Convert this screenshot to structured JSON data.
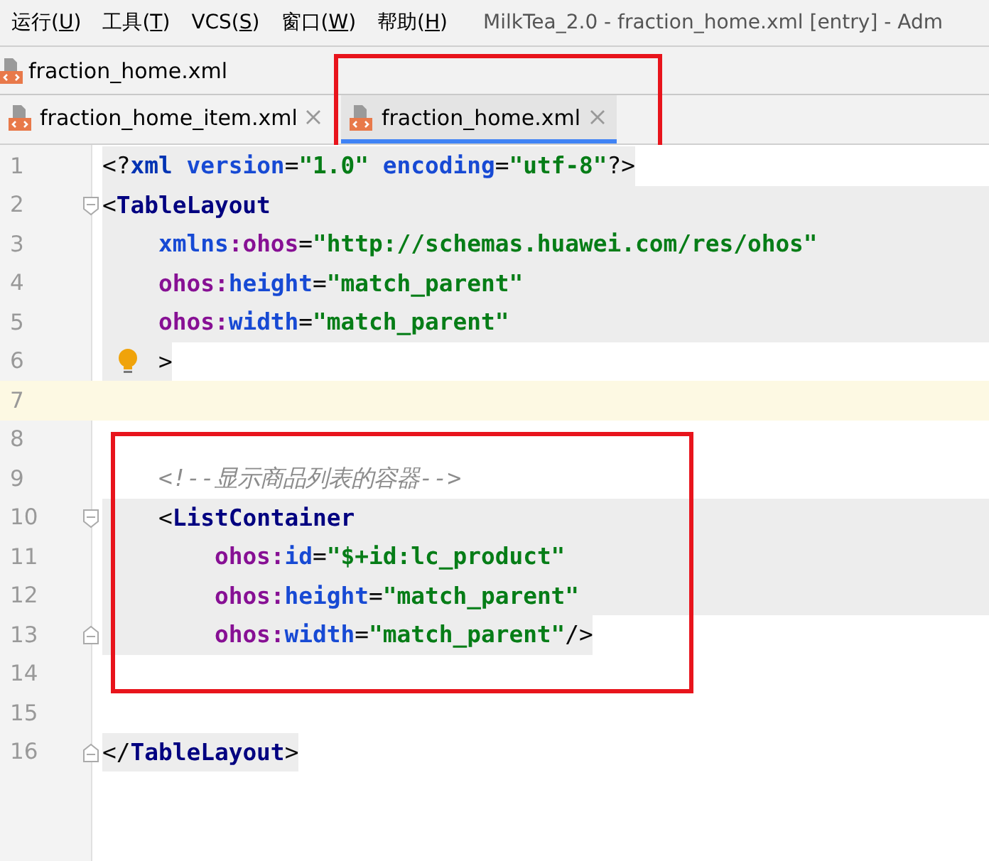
{
  "menu": [
    {
      "label": "运行(",
      "key": "U",
      "tail": ")"
    },
    {
      "label": "工具(",
      "key": "T",
      "tail": ")"
    },
    {
      "label": "VCS(",
      "key": "S",
      "tail": ")"
    },
    {
      "label": "窗口(",
      "key": "W",
      "tail": ")"
    },
    {
      "label": "帮助(",
      "key": "H",
      "tail": ")"
    }
  ],
  "window": {
    "title": "MilkTea_2.0 - fraction_home.xml [entry] - Adm"
  },
  "breadcrumb": {
    "file": "fraction_home.xml"
  },
  "tabs": [
    {
      "label": "fraction_home_item.xml",
      "selected": false,
      "annotated": false
    },
    {
      "label": "fraction_home.xml",
      "selected": true,
      "annotated": true
    }
  ],
  "blocks": [
    {
      "framed": false,
      "lines": [
        {
          "number": "1",
          "text": "<?xml version=\"1.0\" encoding=\"utf-8\"?>",
          "shaded": true,
          "shaded_full": false,
          "current": false,
          "bulb": false
        },
        {
          "number": "2",
          "text": "<TableLayout",
          "shaded": true,
          "shaded_full": true,
          "current": false,
          "bulb": false
        },
        {
          "number": "3",
          "text": "    xmlns:ohos=\"http://schemas.huawei.com/res/ohos\"",
          "shaded": true,
          "shaded_full": true,
          "current": false,
          "bulb": false
        },
        {
          "number": "4",
          "text": "    ohos:height=\"match_parent\"",
          "shaded": true,
          "shaded_full": true,
          "current": false,
          "bulb": false
        },
        {
          "number": "5",
          "text": "    ohos:width=\"match_parent\"",
          "shaded": true,
          "shaded_full": true,
          "current": false,
          "bulb": false
        },
        {
          "number": "6",
          "text": "    >",
          "shaded": true,
          "shaded_full": false,
          "current": false,
          "bulb": true
        },
        {
          "number": "7",
          "current": true,
          "bulb": false
        }
      ]
    },
    {
      "framed": true,
      "lines": [
        {
          "number": "8",
          "current": false,
          "bulb": false
        },
        {
          "number": "9",
          "text": "    <!--显示商品列表的容器-->",
          "shaded": false,
          "shaded_full": false,
          "current": false,
          "bulb": false
        },
        {
          "number": "10",
          "text": "    <ListContainer",
          "shaded": true,
          "shaded_full": true,
          "current": false,
          "bulb": false
        },
        {
          "number": "11",
          "text": "        ohos:id=\"$+id:lc_product\"",
          "shaded": true,
          "shaded_full": true,
          "current": false,
          "bulb": false
        },
        {
          "number": "12",
          "text": "        ohos:height=\"match_parent\"",
          "shaded": true,
          "shaded_full": true,
          "current": false,
          "bulb": false
        },
        {
          "number": "13",
          "text": "        ohos:width=\"match_parent\"/>",
          "shaded": true,
          "shaded_full": false,
          "current": false,
          "bulb": false
        },
        {
          "number": "14",
          "current": false,
          "bulb": false
        }
      ]
    },
    {
      "framed": false,
      "lines": [
        {
          "number": "15",
          "current": false,
          "bulb": false
        },
        {
          "number": "16",
          "text": "</TableLayout>",
          "shaded": true,
          "shaded_full": false,
          "current": false,
          "bulb": false
        }
      ]
    }
  ]
}
